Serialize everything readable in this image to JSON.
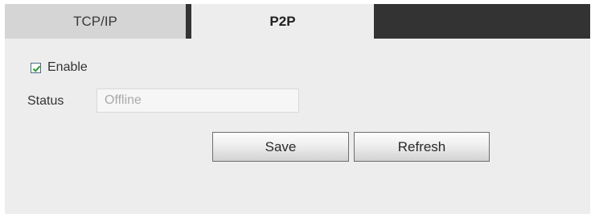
{
  "tabs": [
    {
      "label": "TCP/IP",
      "active": false
    },
    {
      "label": "P2P",
      "active": true
    }
  ],
  "form": {
    "enable_label": "Enable",
    "enable_checked": true,
    "status_label": "Status",
    "status_value": "Offline"
  },
  "buttons": {
    "save_label": "Save",
    "refresh_label": "Refresh"
  },
  "colors": {
    "tab_bar_dark": "#333333",
    "active_tab": "#ededed",
    "inactive_tab": "#d5d5d5",
    "panel": "#ededed",
    "checkmark": "#2e9c2e"
  }
}
